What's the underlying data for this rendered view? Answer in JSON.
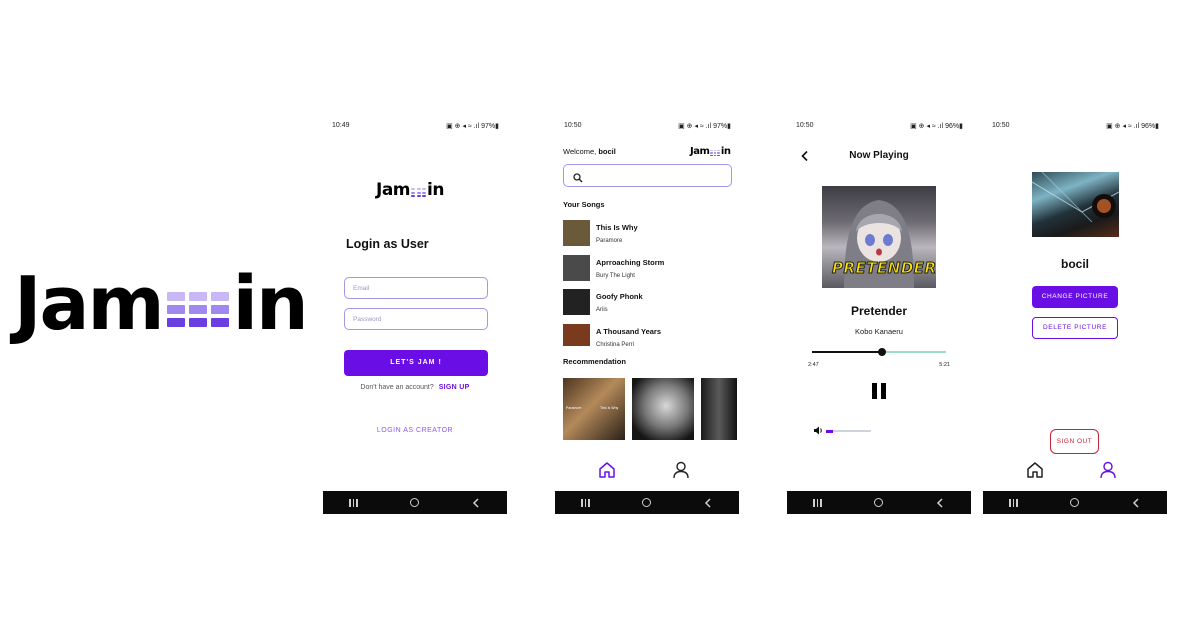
{
  "brand": {
    "logo_left": "Jam",
    "logo_right": "in",
    "eq_colors": [
      "#c8b8f5",
      "#c8b8f5",
      "#c8b8f5",
      "#9f88ee",
      "#9f88ee",
      "#9f88ee",
      "#6a3ee0",
      "#6a3ee0",
      "#6a3ee0"
    ]
  },
  "colors": {
    "accent": "#6a0ee6",
    "accent_light": "#a696e6",
    "danger": "#c8243a",
    "nav_bar": "#0b0b0b"
  },
  "login_screen": {
    "status_time": "10:49",
    "status_right": "▣ ⊕ ◂ ≈ .ıl 97%▮",
    "title": "Login as User",
    "email_placeholder": "Email",
    "password_placeholder": "Password",
    "submit_label": "LET'S JAM !",
    "signup_prompt": "Don't have an account?",
    "signup_link": "SIGN UP",
    "creator_link": "LOGIN AS CREATOR"
  },
  "home_screen": {
    "status_time": "10:50",
    "status_right": "▣ ⊕ ◂ ≈ .ıl 97%▮",
    "welcome_prefix": "Welcome,",
    "welcome_user": "bocil",
    "your_songs_title": "Your Songs",
    "songs": [
      {
        "title": "This Is Why",
        "artist": "Paramore",
        "thumb": "#6b5a3a"
      },
      {
        "title": "Aprroaching Storm",
        "artist": "Bury The Light",
        "thumb": "#4a4a4a"
      },
      {
        "title": "Goofy Phonk",
        "artist": "Ariis",
        "thumb": "#222222"
      },
      {
        "title": "A Thousand Years",
        "artist": "Christina Perri",
        "thumb": "#7a3a1e"
      }
    ],
    "recommendation_title": "Recommendation",
    "rec_cover_labels": [
      "Paramore",
      "This Is Why"
    ]
  },
  "now_playing_screen": {
    "status_time": "10:50",
    "status_right": "▣ ⊕ ◂ ≈ .ıl 96%▮",
    "header": "Now Playing",
    "album_art_text": "PRETENDER",
    "track_title": "Pretender",
    "track_artist": "Kobo Kanaeru",
    "elapsed": "2:47",
    "duration": "5:21",
    "progress_fraction": 0.52,
    "volume_fraction": 0.15
  },
  "profile_screen": {
    "status_time": "10:50",
    "status_right": "▣ ⊕ ◂ ≈ .ıl 96%▮",
    "username": "bocil",
    "change_picture_label": "CHANGE PICTURE",
    "delete_picture_label": "DELETE PICTURE",
    "sign_out_label": "SIGN OUT"
  }
}
